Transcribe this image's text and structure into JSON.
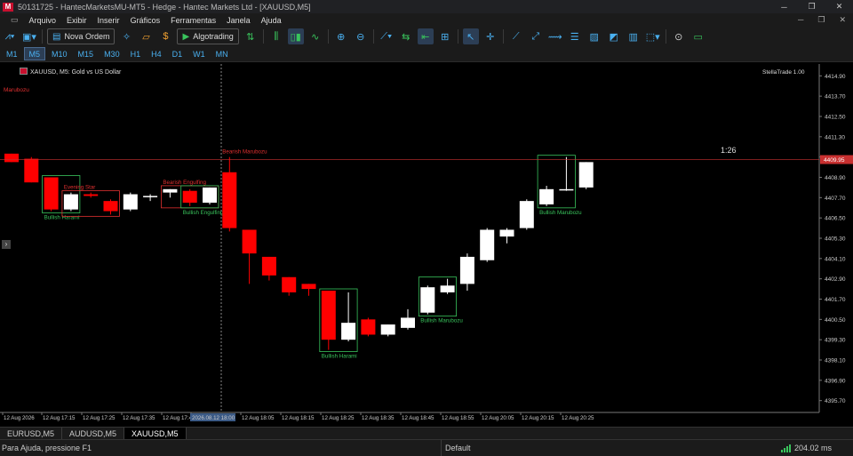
{
  "window": {
    "title": "50131725 - HantecMarketsMU-MT5 - Hedge - Hantec Markets Ltd - [XAUUSD,M5]",
    "logo": "M",
    "minimize": "─",
    "restore": "❐",
    "close": "✕"
  },
  "menu": {
    "items": [
      "Arquivo",
      "Exibir",
      "Inserir",
      "Gráficos",
      "Ferramentas",
      "Janela",
      "Ajuda"
    ]
  },
  "toolbar": {
    "new_order": "Nova Ordem",
    "algotrading": "Algotrading",
    "icons": [
      "chart-type-icon",
      "templates-icon",
      "new-order-icon",
      "strategy-icon",
      "folders-icon",
      "dollar-icon",
      "algotrading-icon",
      "buy-sell-icon",
      "bar-chart-icon",
      "candles-icon",
      "line-chart-icon",
      "zoom-in-icon",
      "zoom-out-icon",
      "indicators-icon",
      "grid-icon",
      "auto-scroll-icon",
      "chart-shift-icon",
      "cursor-icon",
      "crosshair-icon",
      "trend-line-icon",
      "ray-icon",
      "horizontal-line-icon",
      "fibonacci-icon",
      "channel-icon",
      "shapes-icon",
      "text-icon",
      "objects-icon",
      "alerts-icon",
      "battery-icon"
    ]
  },
  "timeframes": [
    "M1",
    "M5",
    "M10",
    "M15",
    "M30",
    "H1",
    "H4",
    "D1",
    "W1",
    "MN"
  ],
  "active_timeframe": "M5",
  "chart": {
    "symbol_label": "XAUUSD, M5:  Gold vs US Dollar",
    "indicator_name": "Marubozu",
    "indicator_badge": "StellaTrade 1.00",
    "countdown": "1:26",
    "current_price": "4409.95",
    "price_ticks": [
      "4414.90",
      "4413.70",
      "4412.50",
      "4411.30",
      "4410.10",
      "4408.90",
      "4407.70",
      "4406.50",
      "4405.30",
      "4404.10",
      "4402.90",
      "4401.70",
      "4400.50",
      "4399.30",
      "4398.10",
      "4396.90",
      "4395.70"
    ],
    "time_ticks": [
      "12 Aug 2026",
      "12 Aug 17:15",
      "12 Aug 17:25",
      "12 Aug 17:35",
      "12 Aug 17:45",
      "2026.08.12 18:00",
      "12 Aug 18:05",
      "12 Aug 18:15",
      "12 Aug 18:25",
      "12 Aug 18:35",
      "12 Aug 18:45",
      "12 Aug 18:55",
      "12 Aug 20:05",
      "12 Aug 20:15",
      "12 Aug 20:25"
    ],
    "patterns": [
      "Bullish Harami",
      "Evening Star",
      "Bearish Engulfing",
      "Bullish Engulfing",
      "Bearish Marubozu",
      "Bullish Harami",
      "Bullish Marubozu",
      "Bullish Marubozu"
    ]
  },
  "chart_data": {
    "type": "candlestick",
    "ylim": [
      4395.0,
      4415.6
    ],
    "candles": [
      {
        "o": 4410.3,
        "h": 4410.3,
        "l": 4409.8,
        "c": 4409.8
      },
      {
        "o": 4410.0,
        "h": 4410.1,
        "l": 4408.6,
        "c": 4408.6
      },
      {
        "o": 4408.9,
        "h": 4408.9,
        "l": 4406.9,
        "c": 4407.0
      },
      {
        "o": 4407.0,
        "h": 4408.0,
        "l": 4406.9,
        "c": 4407.9
      },
      {
        "o": 4407.9,
        "h": 4408.0,
        "l": 4407.7,
        "c": 4407.8
      },
      {
        "o": 4407.5,
        "h": 4407.6,
        "l": 4406.7,
        "c": 4406.9
      },
      {
        "o": 4407.0,
        "h": 4408.0,
        "l": 4406.9,
        "c": 4407.9
      },
      {
        "o": 4407.8,
        "h": 4407.9,
        "l": 4407.5,
        "c": 4407.8
      },
      {
        "o": 4408.0,
        "h": 4408.2,
        "l": 4407.7,
        "c": 4408.2
      },
      {
        "o": 4408.1,
        "h": 4408.2,
        "l": 4407.2,
        "c": 4407.4
      },
      {
        "o": 4407.4,
        "h": 4408.3,
        "l": 4407.3,
        "c": 4408.3
      },
      {
        "o": 4409.2,
        "h": 4410.1,
        "l": 4405.7,
        "c": 4405.9
      },
      {
        "o": 4405.8,
        "h": 4405.8,
        "l": 4402.6,
        "c": 4404.4
      },
      {
        "o": 4404.2,
        "h": 4404.2,
        "l": 4402.8,
        "c": 4403.1
      },
      {
        "o": 4403.0,
        "h": 4403.0,
        "l": 4401.9,
        "c": 4402.1
      },
      {
        "o": 4402.6,
        "h": 4402.6,
        "l": 4401.9,
        "c": 4402.3
      },
      {
        "o": 4402.2,
        "h": 4402.2,
        "l": 4398.7,
        "c": 4399.3
      },
      {
        "o": 4399.3,
        "h": 4402.1,
        "l": 4399.2,
        "c": 4400.3
      },
      {
        "o": 4400.5,
        "h": 4400.6,
        "l": 4399.5,
        "c": 4399.6
      },
      {
        "o": 4399.6,
        "h": 4400.2,
        "l": 4399.5,
        "c": 4400.2
      },
      {
        "o": 4400.0,
        "h": 4401.1,
        "l": 4399.9,
        "c": 4400.6
      },
      {
        "o": 4400.9,
        "h": 4402.5,
        "l": 4400.8,
        "c": 4402.4
      },
      {
        "o": 4402.1,
        "h": 4402.9,
        "l": 4402.0,
        "c": 4402.5
      },
      {
        "o": 4402.6,
        "h": 4404.4,
        "l": 4402.2,
        "c": 4404.2
      },
      {
        "o": 4404.0,
        "h": 4405.9,
        "l": 4403.9,
        "c": 4405.8
      },
      {
        "o": 4405.4,
        "h": 4405.9,
        "l": 4405.0,
        "c": 4405.8
      },
      {
        "o": 4405.9,
        "h": 4407.6,
        "l": 4405.8,
        "c": 4407.5
      },
      {
        "o": 4407.3,
        "h": 4408.4,
        "l": 4407.2,
        "c": 4408.2
      },
      {
        "o": 4408.2,
        "h": 4410.1,
        "l": 4408.1,
        "c": 4408.2
      },
      {
        "o": 4408.3,
        "h": 4409.8,
        "l": 4408.2,
        "c": 4409.8
      }
    ]
  },
  "tabs": [
    "EURUSD,M5",
    "AUDUSD,M5",
    "XAUUSD,M5"
  ],
  "active_tab": "XAUUSD,M5",
  "status": {
    "help": "Para Ajuda, pressione F1",
    "profile": "Default",
    "ping": "204.02 ms"
  },
  "colors": {
    "bull": "#ffffff",
    "bear": "#ff0000",
    "pattern_bull": "#39c45c",
    "pattern_bear": "#e03030",
    "accent": "#4ab0f0"
  }
}
